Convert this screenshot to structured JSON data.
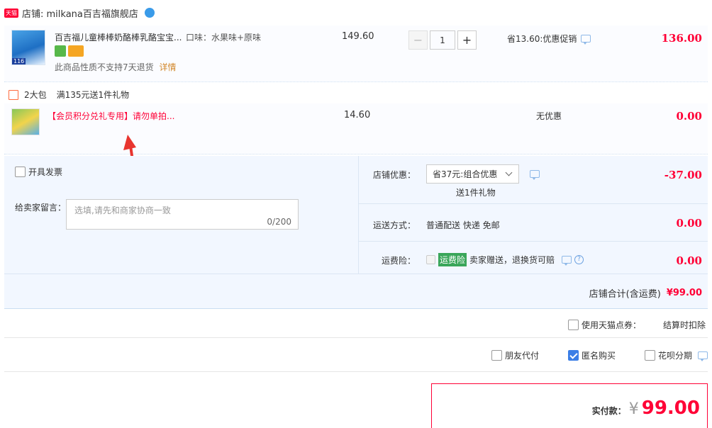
{
  "shop": {
    "badge": "天猫",
    "name": "店铺: milkana百吉福旗舰店"
  },
  "item1": {
    "title": "百吉福儿童棒棒奶酪棒乳酪宝宝...",
    "flavor": "口味：水果味+原味",
    "price": "149.60",
    "quantity": "1",
    "minus": "−",
    "plus": "+",
    "discount": "省13.60:优惠促销",
    "total": "136.00",
    "no_return": "此商品性质不支持7天退货",
    "detail_link": "详情",
    "thumb_badge": "116"
  },
  "gift": {
    "count": "2大包",
    "promo": "满135元送1件礼物",
    "title": "【会员积分兑礼专用】请勿单拍...",
    "price": "14.60",
    "discount": "无优惠",
    "total": "0.00"
  },
  "order": {
    "invoice_label": "开具发票",
    "message_label": "给卖家留言：",
    "message_placeholder": "选填,请先和商家协商一致",
    "message_count": "0/200",
    "shop_discount_label": "店铺优惠：",
    "shop_discount_value": "省37元:组合优惠",
    "shop_discount_sub": "送1件礼物",
    "shop_discount_amount": "-37.00",
    "shipping_label": "运送方式：",
    "shipping_value": "普通配送 快递 免邮",
    "shipping_amount": "0.00",
    "insurance_label": "运费险：",
    "insurance_badge": "运费险",
    "insurance_desc": "卖家赠送，退换货可赔",
    "insurance_amount": "0.00",
    "shop_total_label": "店铺合计(含运费)",
    "shop_total_value": "¥99.00"
  },
  "options": {
    "tmall_points": "使用天猫点券：",
    "tmall_points_note": "结算时扣除",
    "friend_pay": "朋友代付",
    "anonymous": "匿名购买",
    "huabei": "花呗分期"
  },
  "payment": {
    "label": "实付款：",
    "currency": "¥",
    "amount": "99.00"
  }
}
